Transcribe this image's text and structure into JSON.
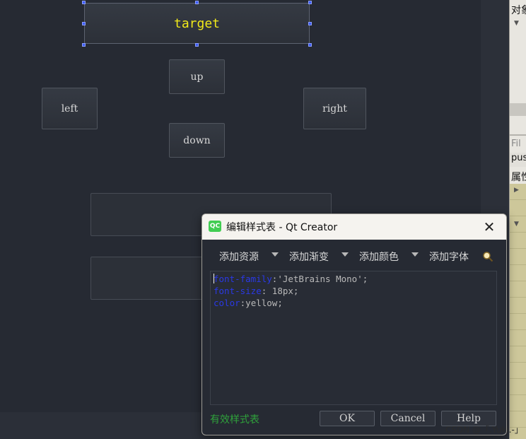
{
  "designer": {
    "buttons": {
      "target": "target",
      "up": "up",
      "left": "left",
      "right": "right",
      "down": "down"
    }
  },
  "side_panel": {
    "object_inspector_title": "对象",
    "filter_placeholder": "Fil",
    "selected_object": "pus",
    "property_title": "属性"
  },
  "dialog": {
    "app_icon": "QC",
    "title": "编辑样式表 - Qt Creator",
    "close_icon": "✕",
    "toolbar": {
      "add_resource": "添加资源",
      "add_gradient": "添加渐变",
      "add_color": "添加颜色",
      "add_font": "添加字体"
    },
    "stylesheet": [
      {
        "property": "font-family",
        "value": "'JetBrains Mono';"
      },
      {
        "property": "font-size",
        "value": " 18px;"
      },
      {
        "property": "color",
        "value": "yellow;"
      }
    ],
    "status": "有效样式表",
    "buttons": {
      "ok": "OK",
      "cancel": "Cancel",
      "help": "Help"
    }
  },
  "watermark": "CSDN @「.Yuki.-」",
  "colors": {
    "canvas": "#262a33",
    "target_text": "#f0e91a",
    "css_keyword": "#2a39e6",
    "valid_text": "#2fa23b",
    "selection_handle": "#3b5cff"
  }
}
